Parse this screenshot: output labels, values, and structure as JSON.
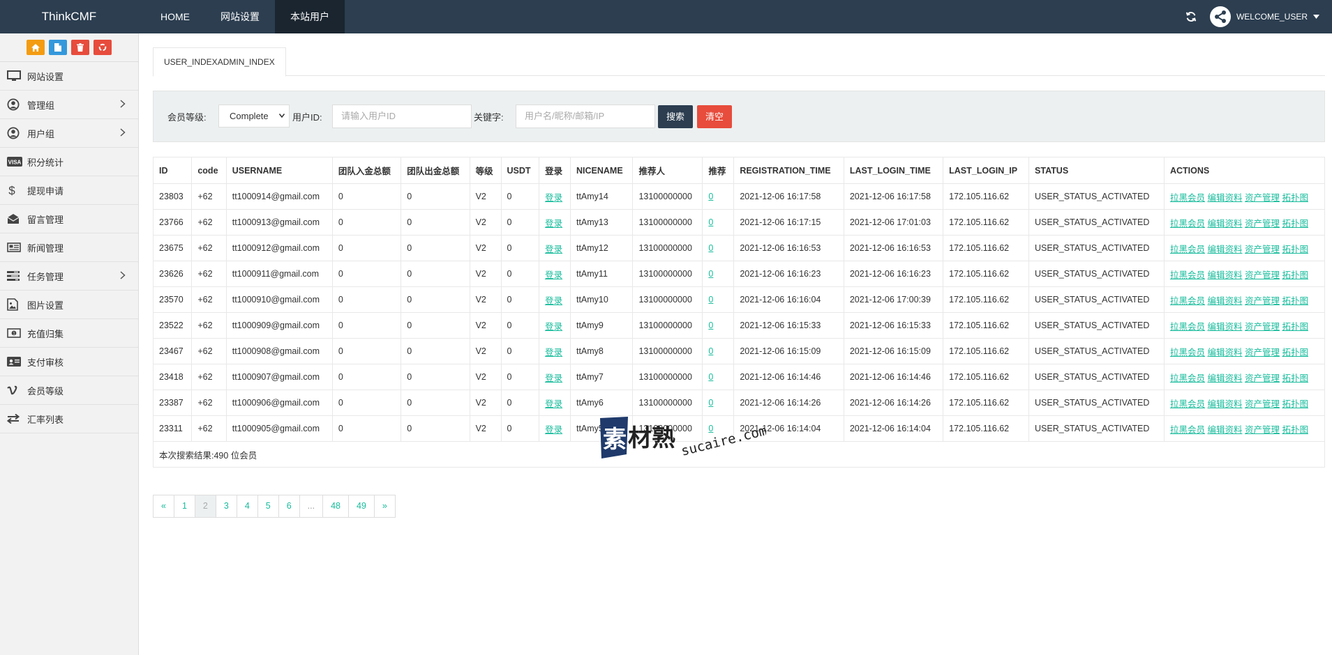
{
  "app": {
    "brand": "ThinkCMF"
  },
  "topnav": [
    {
      "label": "HOME",
      "active": false
    },
    {
      "label": "网站设置",
      "active": false
    },
    {
      "label": "本站用户",
      "active": true
    }
  ],
  "topbar": {
    "welcome": "WELCOME_USER"
  },
  "sidebar": {
    "tools": [
      {
        "icon": "home-icon",
        "color": "#f39c12"
      },
      {
        "icon": "file-icon",
        "color": "#3498db"
      },
      {
        "icon": "trash-icon",
        "color": "#e74c3c"
      },
      {
        "icon": "recycle-icon",
        "color": "#e74c3c"
      }
    ],
    "items": [
      {
        "label": "网站设置",
        "icon": "monitor-icon",
        "has_children": false
      },
      {
        "label": "管理组",
        "icon": "user-circle-icon",
        "has_children": true
      },
      {
        "label": "用户组",
        "icon": "user-circle-icon",
        "has_children": true
      },
      {
        "label": "积分统计",
        "icon": "visa-icon",
        "has_children": false
      },
      {
        "label": "提现申请",
        "icon": "dollar-icon",
        "has_children": false
      },
      {
        "label": "留言管理",
        "icon": "envelope-open-icon",
        "has_children": false
      },
      {
        "label": "新闻管理",
        "icon": "newspaper-icon",
        "has_children": false
      },
      {
        "label": "任务管理",
        "icon": "tasks-icon",
        "has_children": true
      },
      {
        "label": "图片设置",
        "icon": "image-icon",
        "has_children": false
      },
      {
        "label": "充值归集",
        "icon": "money-icon",
        "has_children": false
      },
      {
        "label": "支付审核",
        "icon": "id-card-icon",
        "has_children": false
      },
      {
        "label": "会员等级",
        "icon": "vimeo-icon",
        "has_children": false
      },
      {
        "label": "汇率列表",
        "icon": "exchange-icon",
        "has_children": false
      }
    ]
  },
  "tab": {
    "label": "USER_INDEXADMIN_INDEX"
  },
  "filter": {
    "level_label": "会员等级:",
    "level_value": "Complete",
    "userid_label": "用户ID:",
    "userid_placeholder": "请输入用户ID",
    "keyword_label": "关键字:",
    "keyword_placeholder": "用户名/昵称/邮箱/IP",
    "search_label": "搜索",
    "clear_label": "清空"
  },
  "table": {
    "headers": [
      "ID",
      "code",
      "USERNAME",
      "团队入金总额",
      "团队出金总额",
      "等级",
      "USDT",
      "登录",
      "NICENAME",
      "推荐人",
      "推荐",
      "REGISTRATION_TIME",
      "LAST_LOGIN_TIME",
      "LAST_LOGIN_IP",
      "STATUS",
      "ACTIONS"
    ],
    "rows": [
      {
        "id": "23803",
        "code": "+62",
        "username": "tt1000914@gmail.com",
        "in": "0",
        "out": "0",
        "level": "V2",
        "usdt": "0",
        "login": "登录",
        "nicename": "ttAmy14",
        "referrer": "13100000000",
        "rec": "0",
        "reg": "2021-12-06 16:17:58",
        "last": "2021-12-06 16:17:58",
        "ip": "172.105.116.62",
        "status": "USER_STATUS_ACTIVATED"
      },
      {
        "id": "23766",
        "code": "+62",
        "username": "tt1000913@gmail.com",
        "in": "0",
        "out": "0",
        "level": "V2",
        "usdt": "0",
        "login": "登录",
        "nicename": "ttAmy13",
        "referrer": "13100000000",
        "rec": "0",
        "reg": "2021-12-06 16:17:15",
        "last": "2021-12-06 17:01:03",
        "ip": "172.105.116.62",
        "status": "USER_STATUS_ACTIVATED"
      },
      {
        "id": "23675",
        "code": "+62",
        "username": "tt1000912@gmail.com",
        "in": "0",
        "out": "0",
        "level": "V2",
        "usdt": "0",
        "login": "登录",
        "nicename": "ttAmy12",
        "referrer": "13100000000",
        "rec": "0",
        "reg": "2021-12-06 16:16:53",
        "last": "2021-12-06 16:16:53",
        "ip": "172.105.116.62",
        "status": "USER_STATUS_ACTIVATED"
      },
      {
        "id": "23626",
        "code": "+62",
        "username": "tt1000911@gmail.com",
        "in": "0",
        "out": "0",
        "level": "V2",
        "usdt": "0",
        "login": "登录",
        "nicename": "ttAmy11",
        "referrer": "13100000000",
        "rec": "0",
        "reg": "2021-12-06 16:16:23",
        "last": "2021-12-06 16:16:23",
        "ip": "172.105.116.62",
        "status": "USER_STATUS_ACTIVATED"
      },
      {
        "id": "23570",
        "code": "+62",
        "username": "tt1000910@gmail.com",
        "in": "0",
        "out": "0",
        "level": "V2",
        "usdt": "0",
        "login": "登录",
        "nicename": "ttAmy10",
        "referrer": "13100000000",
        "rec": "0",
        "reg": "2021-12-06 16:16:04",
        "last": "2021-12-06 17:00:39",
        "ip": "172.105.116.62",
        "status": "USER_STATUS_ACTIVATED"
      },
      {
        "id": "23522",
        "code": "+62",
        "username": "tt1000909@gmail.com",
        "in": "0",
        "out": "0",
        "level": "V2",
        "usdt": "0",
        "login": "登录",
        "nicename": "ttAmy9",
        "referrer": "13100000000",
        "rec": "0",
        "reg": "2021-12-06 16:15:33",
        "last": "2021-12-06 16:15:33",
        "ip": "172.105.116.62",
        "status": "USER_STATUS_ACTIVATED"
      },
      {
        "id": "23467",
        "code": "+62",
        "username": "tt1000908@gmail.com",
        "in": "0",
        "out": "0",
        "level": "V2",
        "usdt": "0",
        "login": "登录",
        "nicename": "ttAmy8",
        "referrer": "13100000000",
        "rec": "0",
        "reg": "2021-12-06 16:15:09",
        "last": "2021-12-06 16:15:09",
        "ip": "172.105.116.62",
        "status": "USER_STATUS_ACTIVATED"
      },
      {
        "id": "23418",
        "code": "+62",
        "username": "tt1000907@gmail.com",
        "in": "0",
        "out": "0",
        "level": "V2",
        "usdt": "0",
        "login": "登录",
        "nicename": "ttAmy7",
        "referrer": "13100000000",
        "rec": "0",
        "reg": "2021-12-06 16:14:46",
        "last": "2021-12-06 16:14:46",
        "ip": "172.105.116.62",
        "status": "USER_STATUS_ACTIVATED"
      },
      {
        "id": "23387",
        "code": "+62",
        "username": "tt1000906@gmail.com",
        "in": "0",
        "out": "0",
        "level": "V2",
        "usdt": "0",
        "login": "登录",
        "nicename": "ttAmy6",
        "referrer": "13100000000",
        "rec": "0",
        "reg": "2021-12-06 16:14:26",
        "last": "2021-12-06 16:14:26",
        "ip": "172.105.116.62",
        "status": "USER_STATUS_ACTIVATED"
      },
      {
        "id": "23311",
        "code": "+62",
        "username": "tt1000905@gmail.com",
        "in": "0",
        "out": "0",
        "level": "V2",
        "usdt": "0",
        "login": "登录",
        "nicename": "ttAmy5",
        "referrer": "13100000000",
        "rec": "0",
        "reg": "2021-12-06 16:14:04",
        "last": "2021-12-06 16:14:04",
        "ip": "172.105.116.62",
        "status": "USER_STATUS_ACTIVATED"
      }
    ],
    "actions": [
      "拉黑会员",
      "编辑资料",
      "资产管理",
      "拓扑图"
    ],
    "summary": "本次搜索结果:490 位会员"
  },
  "pagination": [
    {
      "label": "«",
      "state": "link"
    },
    {
      "label": "1",
      "state": "link"
    },
    {
      "label": "2",
      "state": "active"
    },
    {
      "label": "3",
      "state": "link"
    },
    {
      "label": "4",
      "state": "link"
    },
    {
      "label": "5",
      "state": "link"
    },
    {
      "label": "6",
      "state": "link"
    },
    {
      "label": "...",
      "state": "disabled"
    },
    {
      "label": "48",
      "state": "link"
    },
    {
      "label": "49",
      "state": "link"
    },
    {
      "label": "»",
      "state": "link"
    }
  ],
  "watermark": {
    "text_cn": "素材熟",
    "text_en": "sucaire.com"
  },
  "colors": {
    "topbar": "#2c3e50",
    "accent": "#18bc9c",
    "search_btn": "#2c3e50",
    "clear_btn": "#e74c3c"
  }
}
